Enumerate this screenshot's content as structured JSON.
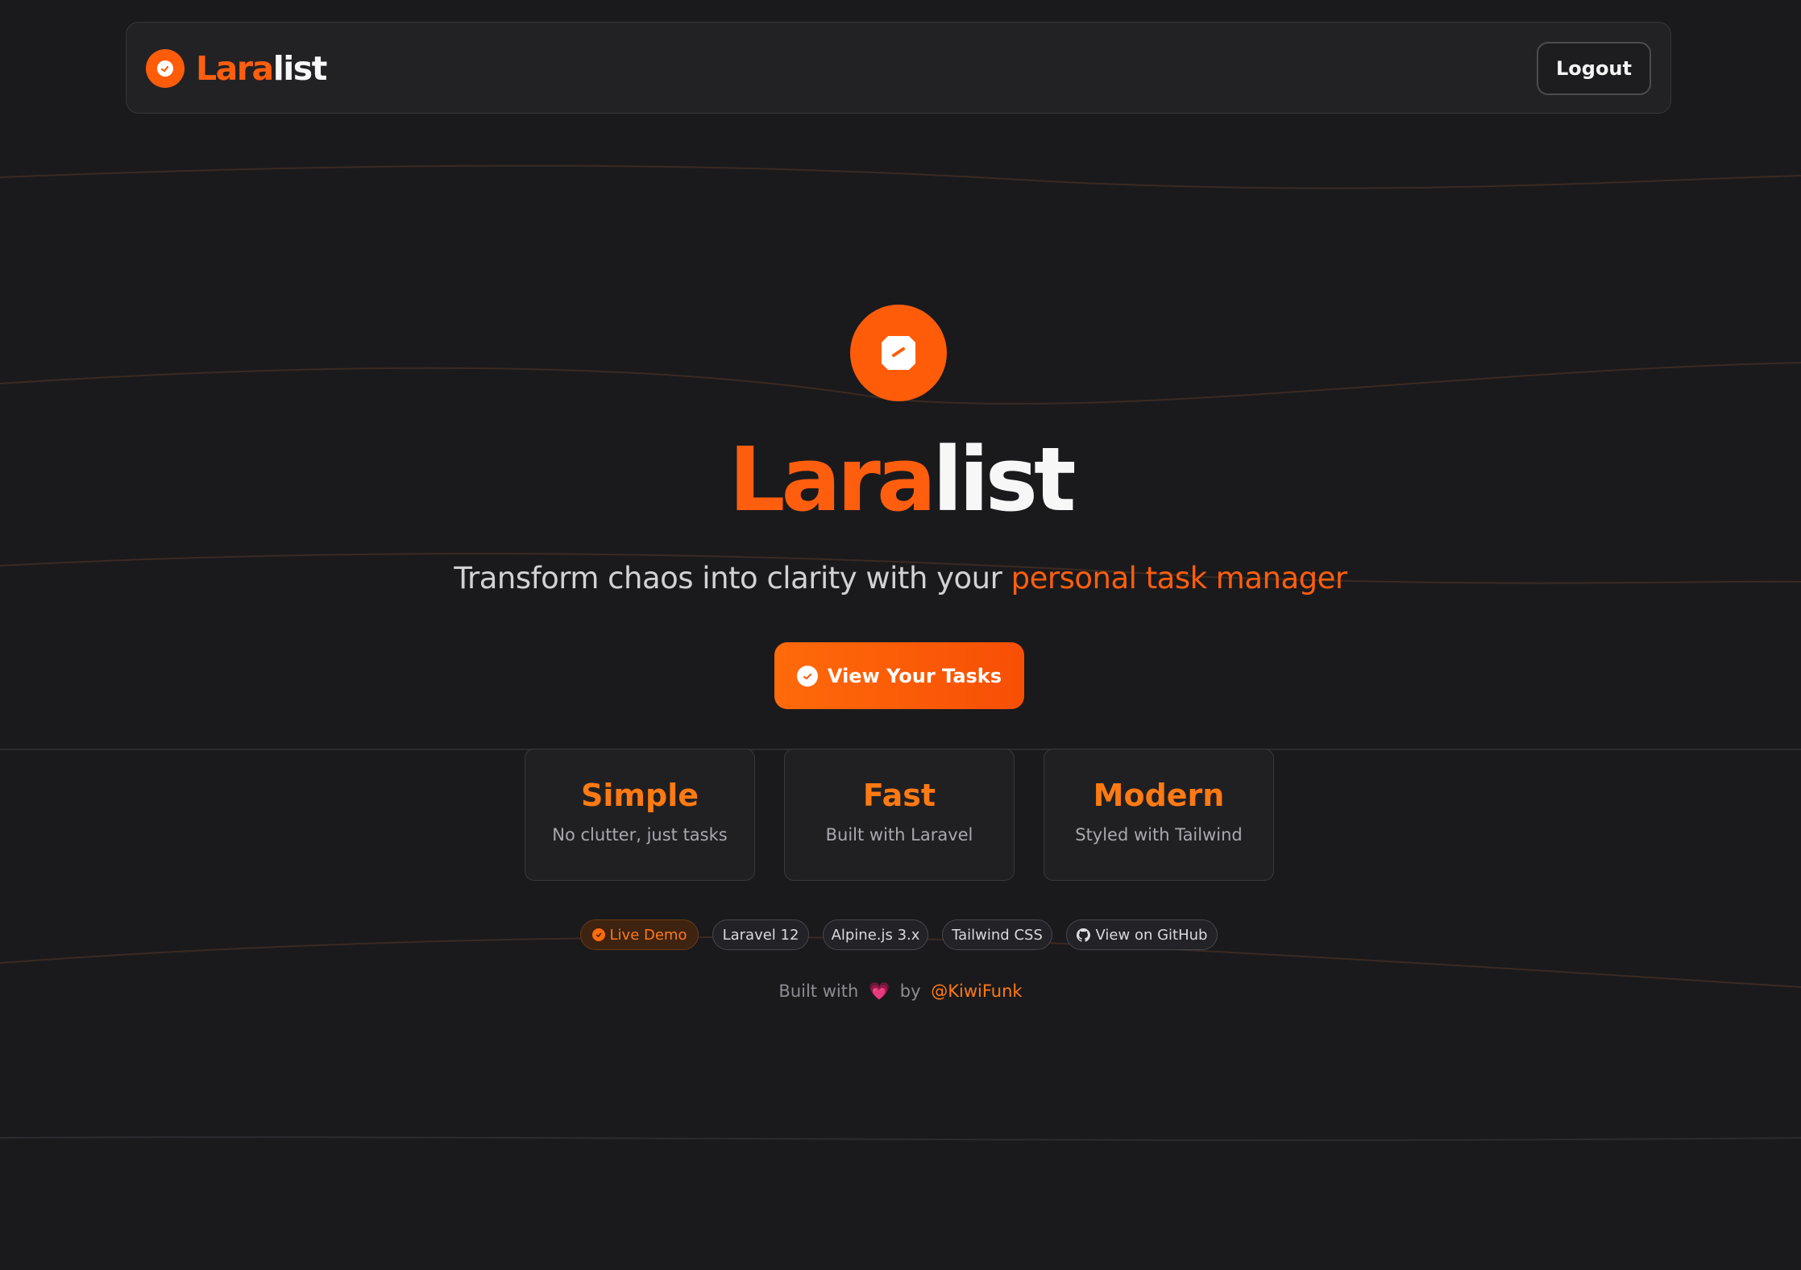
{
  "navbar": {
    "brand_part1": "Lara",
    "brand_part2": "list",
    "logout_label": "Logout"
  },
  "hero": {
    "title_part1": "Lara",
    "title_part2": "list",
    "tagline_prefix": "Transform chaos into clarity with your ",
    "tagline_highlight": "personal task manager",
    "cta_label": "View Your Tasks"
  },
  "features": [
    {
      "title": "Simple",
      "desc": "No clutter, just tasks"
    },
    {
      "title": "Fast",
      "desc": "Built with Laravel"
    },
    {
      "title": "Modern",
      "desc": "Styled with Tailwind"
    }
  ],
  "badges": [
    {
      "label": "Live Demo",
      "icon": "live-dot-icon"
    },
    {
      "label": "Laravel 12"
    },
    {
      "label": "Alpine.js 3.x"
    },
    {
      "label": "Tailwind CSS"
    },
    {
      "label": "View on GitHub",
      "icon": "github-icon"
    }
  ],
  "footer": {
    "prefix": "Built with",
    "heart": "💗",
    "by": "by",
    "author": "@KiwiFunk"
  },
  "colors": {
    "background": "#1a1a1d",
    "accent": "#ff5c0a",
    "accent_text": "#ff7a12",
    "card": "#202023"
  }
}
